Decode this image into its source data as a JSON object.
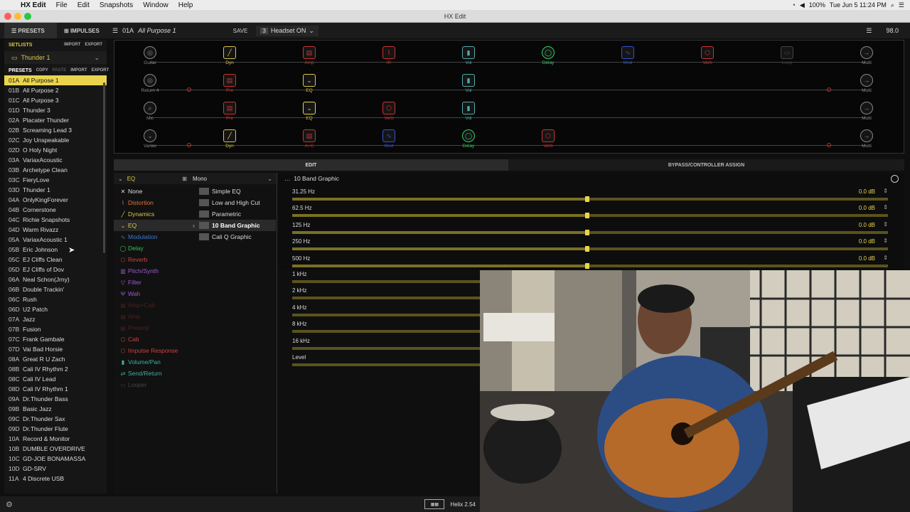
{
  "menubar": {
    "app": "HX Edit",
    "items": [
      "File",
      "Edit",
      "Snapshots",
      "Window",
      "Help"
    ],
    "battery": "100%",
    "datetime": "Tue Jun 5  11:24 PM"
  },
  "window": {
    "title": "HX Edit"
  },
  "toolbar": {
    "tab_presets": "PRESETS",
    "tab_impulses": "IMPULSES",
    "preset_id": "01A",
    "preset_name": "All Purpose 1",
    "save": "SAVE",
    "snapshot_num": "3",
    "snapshot_name": "Headset ON",
    "tempo": "98.0"
  },
  "setlists": {
    "label": "SETLISTS",
    "import": "IMPORT",
    "export": "EXPORT",
    "current": "Thunder 1"
  },
  "presets": {
    "label": "PRESETS",
    "copy": "COPY",
    "paste": "PASTE",
    "import": "IMPORT",
    "export": "EXPORT",
    "items": [
      [
        "01A",
        "All Purpose 1"
      ],
      [
        "01B",
        "All Purpose 2"
      ],
      [
        "01C",
        "All Purpose 3"
      ],
      [
        "01D",
        "Thunder 3"
      ],
      [
        "02A",
        "Placater Thunder"
      ],
      [
        "02B",
        "Screaming Lead 3"
      ],
      [
        "02C",
        "Joy Unspeakable"
      ],
      [
        "02D",
        "O Holy Night"
      ],
      [
        "03A",
        "VariaxAcoustic"
      ],
      [
        "03B",
        "Archetype Clean"
      ],
      [
        "03C",
        "FieryLove"
      ],
      [
        "03D",
        "Thunder 1"
      ],
      [
        "04A",
        "OnlyKingForever"
      ],
      [
        "04B",
        "Cornerstone"
      ],
      [
        "04C",
        "Richie Snapshots"
      ],
      [
        "04D",
        "Warm Rivazz"
      ],
      [
        "05A",
        "VariaxAcoustic 1"
      ],
      [
        "05B",
        "Eric Johnson"
      ],
      [
        "05C",
        "EJ Cliffs Clean"
      ],
      [
        "05D",
        "EJ Cliffs of Dov"
      ],
      [
        "06A",
        "Neal Schon(Jrny)"
      ],
      [
        "06B",
        "Double Trackin'"
      ],
      [
        "06C",
        "Rush"
      ],
      [
        "06D",
        "U2 Patch"
      ],
      [
        "07A",
        "Jazz"
      ],
      [
        "07B",
        "Fusion"
      ],
      [
        "07C",
        "Frank Gambale"
      ],
      [
        "07D",
        "Vai Bad Horsie"
      ],
      [
        "08A",
        "Great R U Zach"
      ],
      [
        "08B",
        "Cali IV Rhythm 2"
      ],
      [
        "08C",
        "Cali IV Lead"
      ],
      [
        "08D",
        "Cali IV Rhythm 1"
      ],
      [
        "09A",
        "Dr.Thunder Bass"
      ],
      [
        "09B",
        "Basic Jazz"
      ],
      [
        "09C",
        "Dr.Thunder Sax"
      ],
      [
        "09D",
        "Dr.Thunder Flute"
      ],
      [
        "10A",
        "Record & Monitor"
      ],
      [
        "10B",
        "DUMBLE OVERDRIVE"
      ],
      [
        "10C",
        "GD-JOE BONAMASSA"
      ],
      [
        "10D",
        "GD-SRV"
      ],
      [
        "11A",
        "4 Discrete USB"
      ]
    ]
  },
  "signal": {
    "paths": [
      [
        {
          "l": "Guitar",
          "c": "#888",
          "g": "◎"
        },
        {
          "l": "Dyn",
          "c": "#d9c64c",
          "g": "╱"
        },
        {
          "l": "Amp",
          "c": "#c33",
          "g": "▤"
        },
        {
          "l": "IR",
          "c": "#c33",
          "g": "⌇"
        },
        {
          "l": "Vol",
          "c": "#5aa",
          "g": "▮"
        },
        {
          "l": "Delay",
          "c": "#3c6",
          "g": "◯"
        },
        {
          "l": "Mod",
          "c": "#35c",
          "g": "∿"
        },
        {
          "l": "Verb",
          "c": "#c33",
          "g": "⬡"
        },
        {
          "l": "Loop",
          "c": "#444",
          "g": "▭"
        },
        {
          "l": "Multi",
          "c": "#888",
          "g": "→"
        }
      ],
      [
        {
          "l": "Return 4",
          "c": "#888",
          "g": "◎"
        },
        {
          "l": "Pre",
          "c": "#c33",
          "g": "▤"
        },
        {
          "l": "EQ",
          "c": "#d9c64c",
          "g": "⌄"
        },
        {
          "l": "Vol",
          "c": "#5aa",
          "g": "▮"
        },
        {
          "l": "Multi",
          "c": "#888",
          "g": "→"
        }
      ],
      [
        {
          "l": "Mic",
          "c": "#888",
          "g": "⌕"
        },
        {
          "l": "Pre",
          "c": "#c33",
          "g": "▤"
        },
        {
          "l": "EQ",
          "c": "#d9c64c",
          "g": "⌄"
        },
        {
          "l": "Verb",
          "c": "#c33",
          "g": "⬡"
        },
        {
          "l": "Vol",
          "c": "#5aa",
          "g": "▮"
        },
        {
          "l": "Multi",
          "c": "#888",
          "g": "→"
        }
      ],
      [
        {
          "l": "Variax",
          "c": "#888",
          "g": "⌄"
        },
        {
          "l": "Dyn",
          "c": "#d9c64c",
          "g": "╱"
        },
        {
          "l": "A+C",
          "c": "#c33",
          "g": "▤"
        },
        {
          "l": "Mod",
          "c": "#35c",
          "g": "∿"
        },
        {
          "l": "Delay",
          "c": "#3c6",
          "g": "◯"
        },
        {
          "l": "Verb",
          "c": "#c33",
          "g": "⬡"
        },
        {
          "l": "Multi",
          "c": "#888",
          "g": "→"
        }
      ]
    ]
  },
  "edit_tabs": {
    "edit": "EDIT",
    "bypass": "BYPASS/CONTROLLER ASSIGN"
  },
  "categories": {
    "current": "EQ",
    "mode": "Mono",
    "items": [
      {
        "l": "None",
        "c": "#ddd"
      },
      {
        "l": "Distortion",
        "c": "#e0743a"
      },
      {
        "l": "Dynamics",
        "c": "#d9c64c"
      },
      {
        "l": "EQ",
        "c": "#d9c64c"
      },
      {
        "l": "Modulation",
        "c": "#3c7ad0"
      },
      {
        "l": "Delay",
        "c": "#3cc05a"
      },
      {
        "l": "Reverb",
        "c": "#d04040"
      },
      {
        "l": "Pitch/Synth",
        "c": "#9a5ad0"
      },
      {
        "l": "Filter",
        "c": "#9a5ad0"
      },
      {
        "l": "Wah",
        "c": "#9a5ad0"
      },
      {
        "l": "Amp+Cab",
        "c": "#4a2222"
      },
      {
        "l": "Amp",
        "c": "#4a2222"
      },
      {
        "l": "Preamp",
        "c": "#4a2222"
      },
      {
        "l": "Cab",
        "c": "#d04040"
      },
      {
        "l": "Impulse Response",
        "c": "#d04040"
      },
      {
        "l": "Volume/Pan",
        "c": "#3fb0a0"
      },
      {
        "l": "Send/Return",
        "c": "#3fb0a0"
      },
      {
        "l": "Looper",
        "c": "#444"
      }
    ]
  },
  "models": [
    "Simple EQ",
    "Low and High Cut",
    "Parametric",
    "10 Band Graphic",
    "Cali Q Graphic"
  ],
  "params": {
    "title": "10 Band Graphic",
    "rows": [
      {
        "l": "31.25 Hz",
        "v": "0.0 dB",
        "pos": 0.5
      },
      {
        "l": "62.5 Hz",
        "v": "0.0 dB",
        "pos": 0.5
      },
      {
        "l": "125 Hz",
        "v": "0.0 dB",
        "pos": 0.5
      },
      {
        "l": "250 Hz",
        "v": "0.0 dB",
        "pos": 0.5
      },
      {
        "l": "500 Hz",
        "v": "0.0 dB",
        "pos": 0.5
      }
    ],
    "hidden_rows": [
      "1 kHz",
      "2 kHz",
      "4 kHz",
      "8 kHz",
      "16 kHz",
      "Level"
    ]
  },
  "bottom": {
    "version": "Helix 2.54"
  }
}
